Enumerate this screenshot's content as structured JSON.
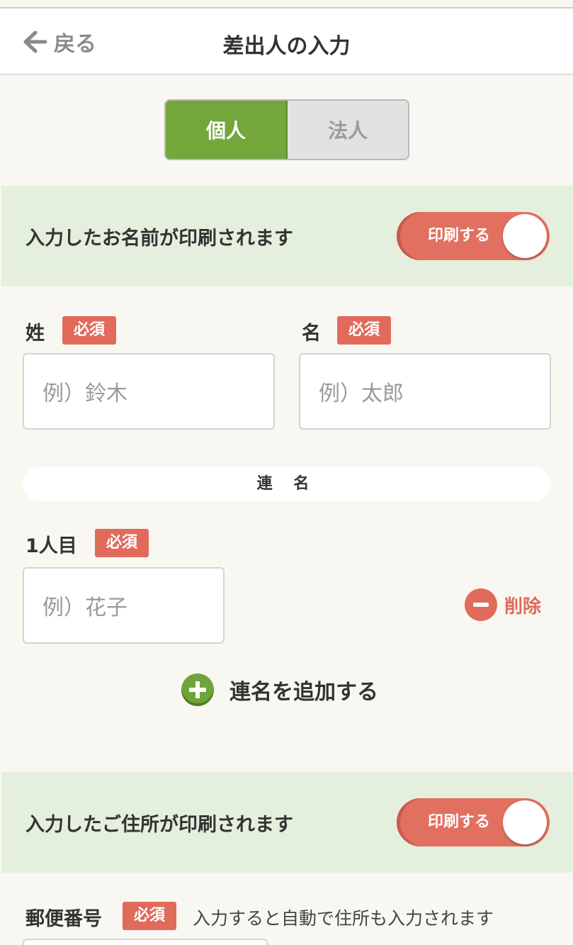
{
  "header": {
    "back_label": "戻る",
    "title": "差出人の入力"
  },
  "type_selector": {
    "options": [
      "個人",
      "法人"
    ],
    "selected": "個人"
  },
  "name_section": {
    "print_label": "入力したお名前が印刷されます",
    "toggle_label": "印刷する",
    "toggle_on": true
  },
  "name_fields": {
    "last_name_label": "姓",
    "first_name_label": "名",
    "required_label": "必須",
    "last_name_placeholder": "例）鈴木",
    "first_name_placeholder": "例）太郎"
  },
  "joint_names": {
    "section_label": "連 名",
    "person_label": "1人目",
    "person_placeholder": "例）花子",
    "delete_label": "削除",
    "add_label": "連名を追加する"
  },
  "address_section": {
    "print_label": "入力したご住所が印刷されます",
    "toggle_label": "印刷する",
    "toggle_on": true
  },
  "postal": {
    "label": "郵便番号",
    "hint": "入力すると自動で住所も入力されます"
  },
  "colors": {
    "accent_green": "#73a63b",
    "accent_red": "#e06b5b",
    "band_green": "#e5efdd",
    "background": "#f9f7f1"
  }
}
